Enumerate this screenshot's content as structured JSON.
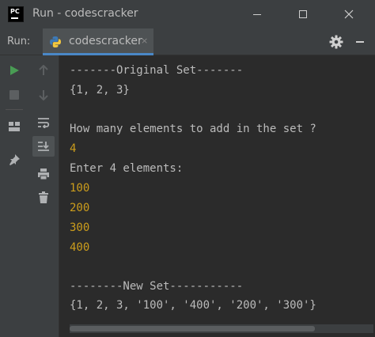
{
  "window": {
    "title": "Run - codescracker",
    "logo_text": "PC"
  },
  "run_panel": {
    "label": "Run:",
    "tab_label": "codescracker",
    "tab_close": "×"
  },
  "console": {
    "lines": [
      {
        "text": "-------Original Set-------",
        "kind": "output"
      },
      {
        "text": "{1, 2, 3}",
        "kind": "output"
      },
      {
        "text": "",
        "kind": "output"
      },
      {
        "text": "How many elements to add in the set ?",
        "kind": "output"
      },
      {
        "text": "4",
        "kind": "input"
      },
      {
        "text": "Enter 4 elements:",
        "kind": "output"
      },
      {
        "text": "100",
        "kind": "input"
      },
      {
        "text": "200",
        "kind": "input"
      },
      {
        "text": "300",
        "kind": "input"
      },
      {
        "text": "400",
        "kind": "input"
      },
      {
        "text": "",
        "kind": "output"
      },
      {
        "text": "--------New Set-----------",
        "kind": "output"
      },
      {
        "text": "{1, 2, 3, '100', '400', '200', '300'}",
        "kind": "output"
      }
    ]
  },
  "colors": {
    "background": "#2b2b2b",
    "chrome": "#3c3f41",
    "output_text": "#bbbbbb",
    "input_text": "#cc9d1c",
    "run_green": "#499c54",
    "tab_underline": "#4a88c7"
  },
  "icons": {
    "left_toolbar": [
      "rerun-icon",
      "stop-icon",
      "layout-icon",
      "pin-icon"
    ],
    "right_toolbar": [
      "up-arrow-icon",
      "down-arrow-icon",
      "soft-wrap-icon",
      "scroll-to-end-icon",
      "print-icon",
      "trash-icon"
    ],
    "header": [
      "gear-icon",
      "minimize-icon"
    ]
  }
}
